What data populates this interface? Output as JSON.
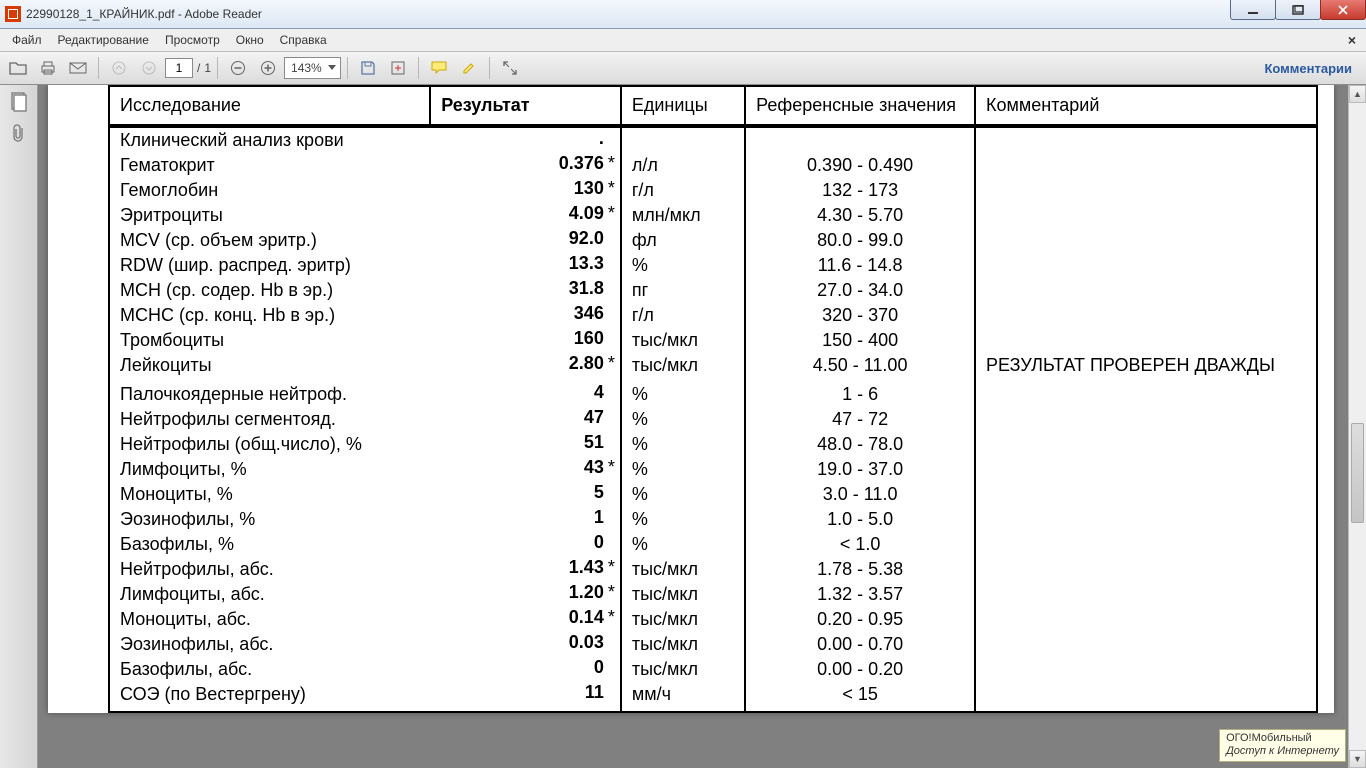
{
  "titlebar": {
    "title": "22990128_1_КРАЙНИК.pdf - Adobe Reader"
  },
  "menu": {
    "file": "Файл",
    "edit": "Редактирование",
    "view": "Просмотр",
    "window": "Окно",
    "help": "Справка"
  },
  "toolbar": {
    "page_current": "1",
    "page_sep": "/",
    "page_total": "1",
    "zoom": "143%",
    "comments": "Комментарии"
  },
  "headers": {
    "name": "Исследование",
    "result": "Результат",
    "units": "Единицы",
    "ref": "Референсные значения",
    "comment": "Комментарий"
  },
  "rows": [
    {
      "name": "Клинический анализ крови",
      "result": ".",
      "flag": "",
      "units": "",
      "ref": "",
      "comment": ""
    },
    {
      "name": "Гематокрит",
      "result": "0.376",
      "flag": "*",
      "units": "л/л",
      "ref": "0.390 - 0.490",
      "comment": ""
    },
    {
      "name": "Гемоглобин",
      "result": "130",
      "flag": "*",
      "units": "г/л",
      "ref": "132 - 173",
      "comment": ""
    },
    {
      "name": "Эритроциты",
      "result": "4.09",
      "flag": "*",
      "units": "млн/мкл",
      "ref": "4.30 - 5.70",
      "comment": ""
    },
    {
      "name": "MCV (ср. объем эритр.)",
      "result": "92.0",
      "flag": "",
      "units": "фл",
      "ref": "80.0 - 99.0",
      "comment": ""
    },
    {
      "name": "RDW (шир. распред. эритр)",
      "result": "13.3",
      "flag": "",
      "units": "%",
      "ref": "11.6 - 14.8",
      "comment": ""
    },
    {
      "name": "MCH (ср. содер. Hb в эр.)",
      "result": "31.8",
      "flag": "",
      "units": "пг",
      "ref": "27.0 - 34.0",
      "comment": ""
    },
    {
      "name": "MCHC (ср. конц. Hb в эр.)",
      "result": "346",
      "flag": "",
      "units": "г/л",
      "ref": "320 - 370",
      "comment": ""
    },
    {
      "name": "Тромбоциты",
      "result": "160",
      "flag": "",
      "units": "тыс/мкл",
      "ref": "150 - 400",
      "comment": ""
    },
    {
      "name": "Лейкоциты",
      "result": "2.80",
      "flag": "*",
      "units": "тыс/мкл",
      "ref": "4.50 - 11.00",
      "comment": "РЕЗУЛЬТАТ ПРОВЕРЕН ДВАЖДЫ"
    },
    {
      "name": " ",
      "result": "",
      "flag": "",
      "units": "",
      "ref": "",
      "comment": ""
    },
    {
      "name": "Палочкоядерные нейтроф.",
      "result": "4",
      "flag": "",
      "units": "%",
      "ref": "1 - 6",
      "comment": ""
    },
    {
      "name": "Нейтрофилы сегментояд.",
      "result": "47",
      "flag": "",
      "units": "%",
      "ref": "47 - 72",
      "comment": ""
    },
    {
      "name": "Нейтрофилы (общ.число), %",
      "result": "51",
      "flag": "",
      "units": "%",
      "ref": "48.0 - 78.0",
      "comment": ""
    },
    {
      "name": "Лимфоциты, %",
      "result": "43",
      "flag": "*",
      "units": "%",
      "ref": "19.0 - 37.0",
      "comment": ""
    },
    {
      "name": "Моноциты, %",
      "result": "5",
      "flag": "",
      "units": "%",
      "ref": "3.0 - 11.0",
      "comment": ""
    },
    {
      "name": "Эозинофилы, %",
      "result": "1",
      "flag": "",
      "units": "%",
      "ref": "1.0 - 5.0",
      "comment": ""
    },
    {
      "name": "Базофилы, %",
      "result": "0",
      "flag": "",
      "units": "%",
      "ref": "< 1.0",
      "comment": ""
    },
    {
      "name": "Нейтрофилы, абс.",
      "result": "1.43",
      "flag": "*",
      "units": "тыс/мкл",
      "ref": "1.78 - 5.38",
      "comment": ""
    },
    {
      "name": "Лимфоциты, абс.",
      "result": "1.20",
      "flag": "*",
      "units": "тыс/мкл",
      "ref": "1.32 - 3.57",
      "comment": ""
    },
    {
      "name": "Моноциты, абс.",
      "result": "0.14",
      "flag": "*",
      "units": "тыс/мкл",
      "ref": "0.20 - 0.95",
      "comment": ""
    },
    {
      "name": "Эозинофилы, абс.",
      "result": "0.03",
      "flag": "",
      "units": "тыс/мкл",
      "ref": "0.00 - 0.70",
      "comment": ""
    },
    {
      "name": "Базофилы, абс.",
      "result": "0",
      "flag": "",
      "units": "тыс/мкл",
      "ref": "0.00 - 0.20",
      "comment": ""
    },
    {
      "name": "СОЭ (по Вестергрену)",
      "result": "11",
      "flag": "",
      "units": "мм/ч",
      "ref": "< 15",
      "comment": ""
    }
  ],
  "tooltip": {
    "line1": "ОГО!Мобильный",
    "line2": "Доступ к Интернету"
  }
}
